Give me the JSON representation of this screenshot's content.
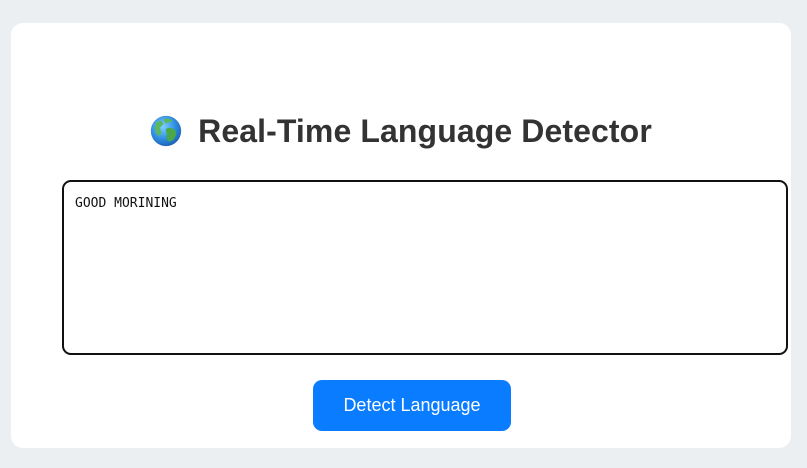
{
  "header": {
    "icon": "globe-icon",
    "title": "Real-Time Language Detector"
  },
  "input": {
    "value": "GOOD MORINING"
  },
  "actions": {
    "detect_label": "Detect Language"
  },
  "colors": {
    "page_background": "#eceff1",
    "card_background": "#ffffff",
    "title_text": "#333333",
    "button_background": "#0a7cff",
    "button_text": "#ffffff",
    "input_border": "#111111"
  }
}
